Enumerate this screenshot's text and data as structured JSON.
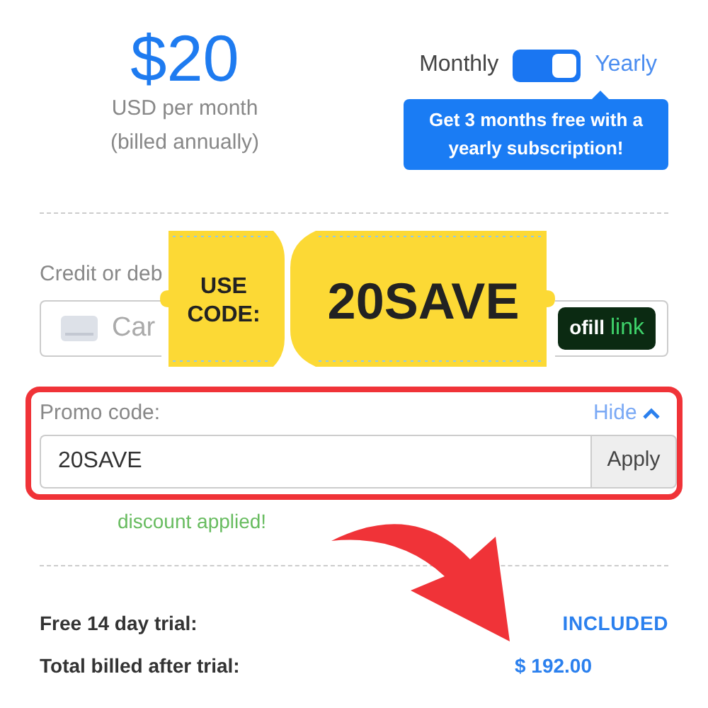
{
  "plan": {
    "price": "$20",
    "note_lines": [
      "USD per month",
      "(billed annually)"
    ]
  },
  "billing_toggle": {
    "left_label": "Monthly",
    "right_label": "Yearly",
    "on": true
  },
  "tooltip": {
    "text": "Get 3 months free with a yearly subscription!"
  },
  "card": {
    "label": "Credit or deb",
    "placeholder": "Car",
    "autofill_prefix": "ofill",
    "autofill_brand": "link"
  },
  "coupon": {
    "lead": "USE CODE:",
    "code": "20SAVE"
  },
  "promo": {
    "label": "Promo code:",
    "toggle_link": "Hide",
    "expanded": true,
    "value": "20SAVE",
    "button": "Apply",
    "status": "discount applied!"
  },
  "summary": [
    {
      "label": "Free 14 day trial:",
      "value": "INCLUDED",
      "kind": "caps"
    },
    {
      "label": "Total billed after trial:",
      "value": "$ 192.00",
      "kind": "amount"
    }
  ]
}
